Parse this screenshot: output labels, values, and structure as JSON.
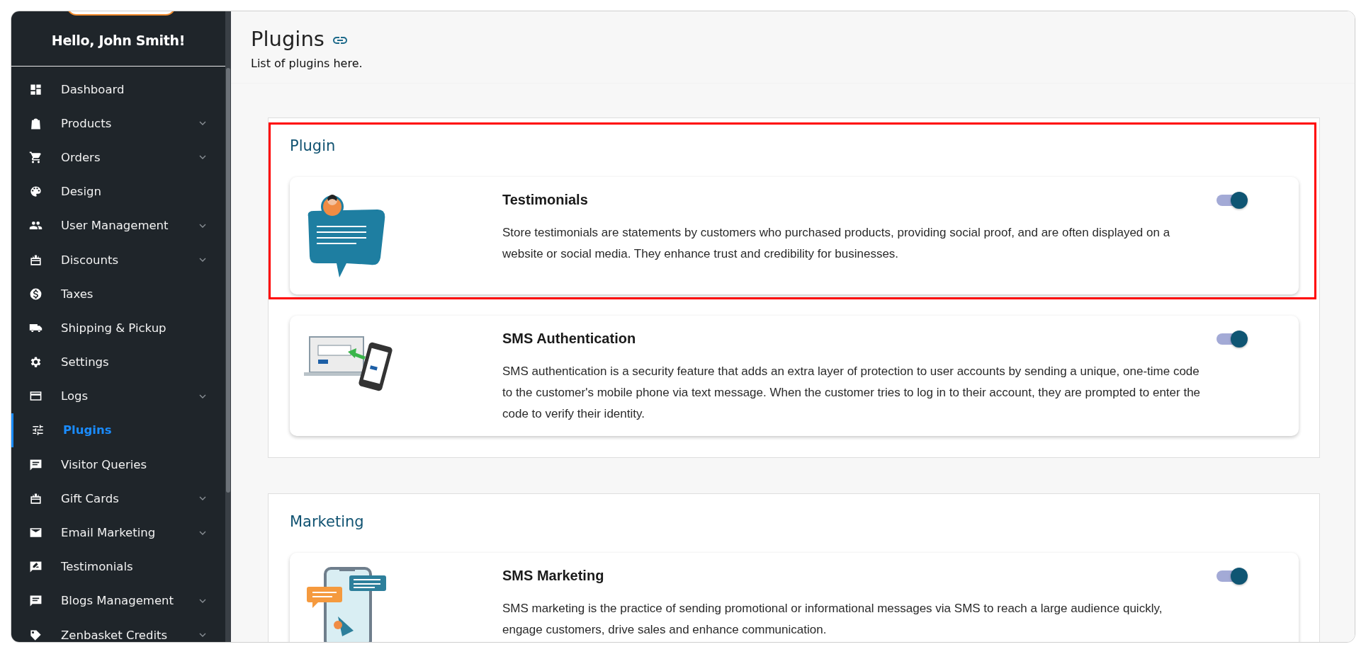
{
  "sidebar": {
    "greeting": "Hello, John Smith!",
    "items": [
      {
        "label": "Dashboard",
        "expandable": false,
        "selected": false
      },
      {
        "label": "Products",
        "expandable": true,
        "selected": false
      },
      {
        "label": "Orders",
        "expandable": true,
        "selected": false
      },
      {
        "label": "Design",
        "expandable": false,
        "selected": false
      },
      {
        "label": "User Management",
        "expandable": true,
        "selected": false
      },
      {
        "label": "Discounts",
        "expandable": true,
        "selected": false
      },
      {
        "label": "Taxes",
        "expandable": false,
        "selected": false
      },
      {
        "label": "Shipping & Pickup",
        "expandable": false,
        "selected": false
      },
      {
        "label": "Settings",
        "expandable": false,
        "selected": false
      },
      {
        "label": "Logs",
        "expandable": true,
        "selected": false
      },
      {
        "label": "Plugins",
        "expandable": false,
        "selected": true
      },
      {
        "label": "Visitor Queries",
        "expandable": false,
        "selected": false
      },
      {
        "label": "Gift Cards",
        "expandable": true,
        "selected": false
      },
      {
        "label": "Email Marketing",
        "expandable": true,
        "selected": false
      },
      {
        "label": "Testimonials",
        "expandable": false,
        "selected": false
      },
      {
        "label": "Blogs Management",
        "expandable": true,
        "selected": false
      },
      {
        "label": "Zenbasket Credits",
        "expandable": true,
        "selected": false
      }
    ]
  },
  "page": {
    "title": "Plugins",
    "subtitle": "List of plugins here."
  },
  "sections": [
    {
      "heading": "Plugin",
      "highlighted": true,
      "plugins": [
        {
          "name": "Testimonials",
          "description": "Store testimonials are statements by customers who purchased products, providing social proof, and are often displayed on a website or social media. They enhance trust and credibility for businesses.",
          "on": true
        },
        {
          "name": "SMS Authentication",
          "description": "SMS authentication is a security feature that adds an extra layer of protection to user accounts by sending a unique, one-time code to the customer's mobile phone via text message. When the customer tries to log in to their account, they are prompted to enter the code to verify their identity.",
          "on": true
        }
      ]
    },
    {
      "heading": "Marketing",
      "highlighted": false,
      "plugins": [
        {
          "name": "SMS Marketing",
          "description": "SMS marketing is the practice of sending promotional or informational messages via SMS to reach a large audience quickly, engage customers, drive sales and enhance communication.",
          "on": true
        }
      ]
    }
  ]
}
